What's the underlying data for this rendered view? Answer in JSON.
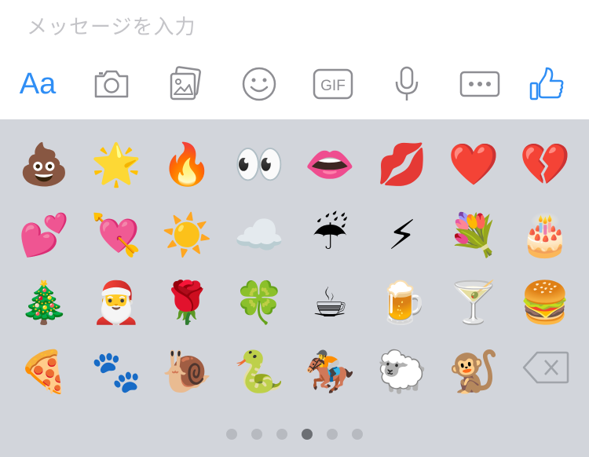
{
  "composer": {
    "placeholder": "メッセージを入力"
  },
  "toolbar": {
    "aa_label": "Aa",
    "gif_label": "GIF",
    "accent_color": "#2f8ef5",
    "icon_color": "#8e8e93",
    "icons": [
      "text-format-icon",
      "camera-icon",
      "photo-gallery-icon",
      "smiley-icon",
      "gif-icon",
      "microphone-icon",
      "more-icon",
      "thumbs-up-icon"
    ]
  },
  "emoji_keyboard": {
    "background": "#d2d5db",
    "rows": [
      [
        {
          "char": "💩",
          "name": "pile-of-poo"
        },
        {
          "char": "🌟",
          "name": "glowing-star"
        },
        {
          "char": "🔥",
          "name": "fire"
        },
        {
          "char": "👀",
          "name": "eyes"
        },
        {
          "char": "👄",
          "name": "mouth"
        },
        {
          "char": "💋",
          "name": "kiss-mark"
        },
        {
          "char": "❤️",
          "name": "red-heart"
        },
        {
          "char": "💔",
          "name": "broken-heart"
        }
      ],
      [
        {
          "char": "💕",
          "name": "two-hearts"
        },
        {
          "char": "💘",
          "name": "heart-with-arrow"
        },
        {
          "char": "☀️",
          "name": "sun"
        },
        {
          "char": "☁️",
          "name": "cloud"
        },
        {
          "char": "☔",
          "name": "umbrella-with-rain"
        },
        {
          "char": "⚡",
          "name": "high-voltage"
        },
        {
          "char": "💐",
          "name": "bouquet"
        },
        {
          "char": "🎂",
          "name": "birthday-cake"
        }
      ],
      [
        {
          "char": "🎄",
          "name": "christmas-tree"
        },
        {
          "char": "🎅",
          "name": "santa-claus"
        },
        {
          "char": "🌹",
          "name": "rose"
        },
        {
          "char": "🍀",
          "name": "four-leaf-clover"
        },
        {
          "char": "☕",
          "name": "hot-beverage"
        },
        {
          "char": "🍺",
          "name": "beer-mug"
        },
        {
          "char": "🍸",
          "name": "cocktail-glass"
        },
        {
          "char": "🍔",
          "name": "hamburger"
        }
      ],
      [
        {
          "char": "🍕",
          "name": "pizza"
        },
        {
          "char": "🐾",
          "name": "paw-prints"
        },
        {
          "char": "🐌",
          "name": "snail"
        },
        {
          "char": "🐍",
          "name": "snake"
        },
        {
          "char": "🏇",
          "name": "horse-racing"
        },
        {
          "char": "🐑",
          "name": "ewe"
        },
        {
          "char": "🐒",
          "name": "monkey"
        }
      ]
    ],
    "page_count": 6,
    "active_page": 4
  }
}
